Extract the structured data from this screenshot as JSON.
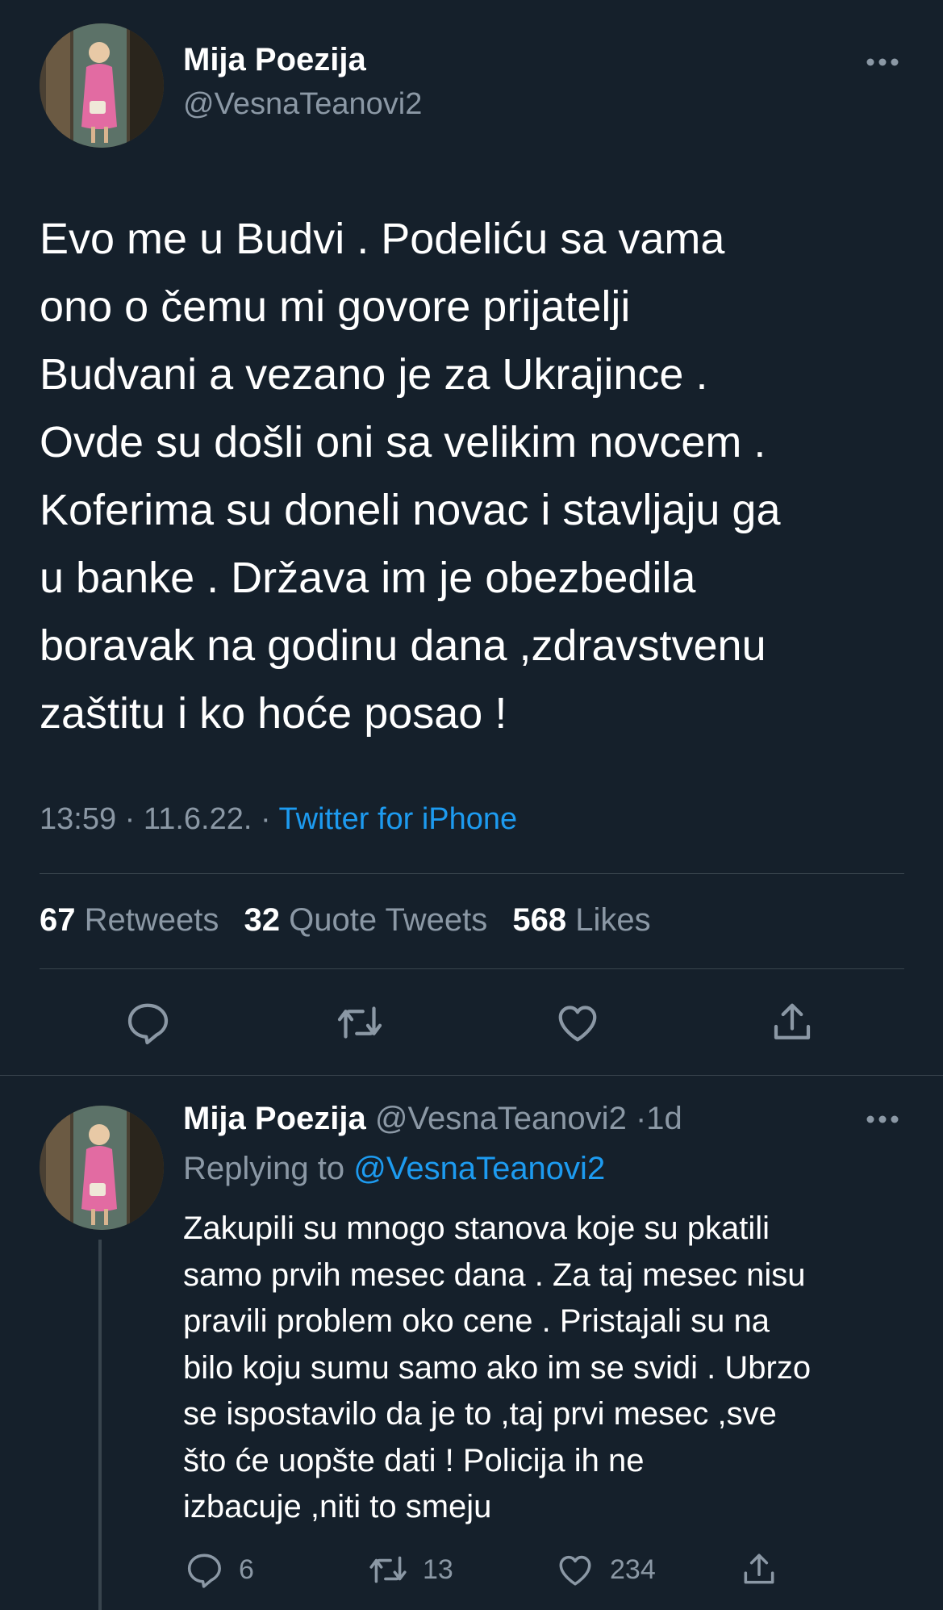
{
  "tweet": {
    "author_name": "Mija Poezija",
    "author_handle": "@VesnaTeanovi2",
    "text": "Evo me u Budvi . Podeliću sa vama\nono o čemu mi govore prijatelji\nBudvani a vezano je za Ukrajince .\nOvde su došli oni sa velikim novcem .\nKoferima su doneli novac i stavljaju ga\nu banke . Država im je obezbedila\nboravak na godinu dana ,zdravstvenu\nzaštitu i ko hoće posao !",
    "time": "13:59",
    "date": "11.6.22.",
    "separator": "·",
    "source": "Twitter for iPhone",
    "stats": {
      "retweets_count": "67",
      "retweets_label": "Retweets",
      "quotes_count": "32",
      "quotes_label": "Quote Tweets",
      "likes_count": "568",
      "likes_label": "Likes"
    }
  },
  "reply": {
    "author_name": "Mija Poezija",
    "author_handle": "@VesnaTeanovi2",
    "separator": "·",
    "time_ago": "1d",
    "replying_label": "Replying to",
    "replying_handle": "@VesnaTeanovi2",
    "text": "Zakupili su mnogo stanova koje su pkatili\nsamo prvih mesec dana . Za taj mesec nisu\npravili problem oko cene . Pristajali su na\nbilo koju sumu samo ako im se svidi . Ubrzo\nse ispostavilo da je to ,taj prvi mesec ,sve\nšto će uopšte dati ! Policija ih ne\nizbacuje ,niti to smeju",
    "replies_count": "6",
    "retweets_count": "13",
    "likes_count": "234"
  },
  "icons": {
    "more": "more-horizontal-icon",
    "reply": "reply-icon",
    "retweet": "retweet-icon",
    "like": "heart-icon",
    "share": "share-icon"
  },
  "colors": {
    "background": "#15202b",
    "text": "#ffffff",
    "secondary": "#8b98a5",
    "accent": "#1d9bf0",
    "divider": "#38444d"
  }
}
